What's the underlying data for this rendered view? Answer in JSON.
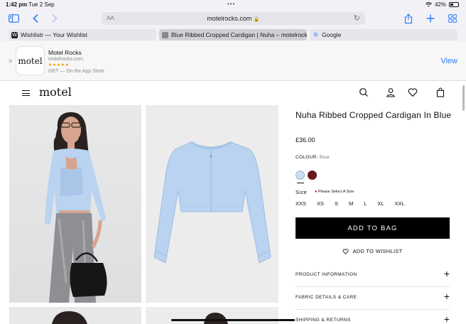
{
  "status_bar": {
    "time": "1:42 pm",
    "date": "Tue 2 Sep",
    "dots": "•••",
    "battery": "42%",
    "battery_level": 0.42
  },
  "toolbar": {
    "text_size_label": "AA",
    "url": "motelrocks.com",
    "icons": [
      "sidebar-icon",
      "back-icon",
      "forward-icon",
      "reload-icon",
      "share-icon",
      "new-tab-icon",
      "tab-overview-icon"
    ]
  },
  "tabs": [
    {
      "label": "Wishlistr — Your Wishlist",
      "favicon": "W",
      "active": false
    },
    {
      "label": "Blue Ribbed Cropped Cardigan | Nuha – motelrocks",
      "favicon": "",
      "active": true
    },
    {
      "label": "Google",
      "favicon": "G",
      "active": false
    }
  ],
  "app_banner": {
    "logo_text": "motel",
    "name": "Motel Rocks",
    "domain": "motelrocks.com",
    "stars": "★★★★★",
    "subtitle": "GET — On the App Store",
    "view_label": "View"
  },
  "site": {
    "logo": "motel"
  },
  "product": {
    "title": "Nuha Ribbed Cropped Cardigan In Blue",
    "price": "£36.00",
    "colour_label": "COLOUR:",
    "colour_value": "Blue",
    "swatches": [
      "#c9dcf1",
      "#6a1621"
    ],
    "size_label": "Size",
    "size_warning": "Please Select A Size",
    "sizes": [
      "XXS",
      "XS",
      "S",
      "M",
      "L",
      "XL",
      "XXL"
    ],
    "add_to_bag": "ADD TO BAG",
    "add_to_wishlist": "ADD TO WISHLIST",
    "accordions": [
      "PRODUCT INFORMATION",
      "FABRIC DETAILS & CARE",
      "SHIPPING & RETURNS"
    ]
  },
  "colors": {
    "accent": "#2f7cf6",
    "cardigan_blue": "#b9d3f0",
    "button_black": "#000000"
  }
}
